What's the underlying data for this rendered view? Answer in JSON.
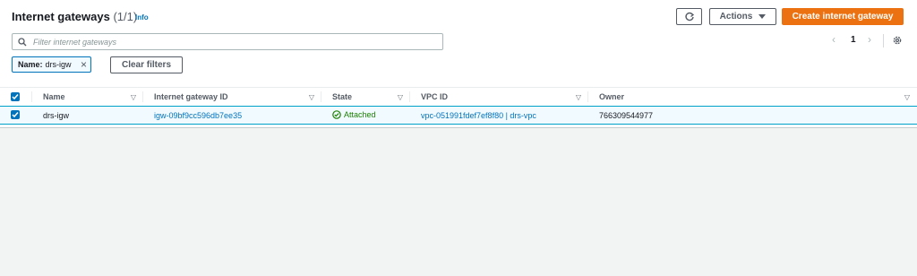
{
  "header": {
    "title": "Internet gateways",
    "count": "(1/1)",
    "info": "Info",
    "actions_label": "Actions",
    "create_label": "Create internet gateway"
  },
  "search": {
    "placeholder": "Filter internet gateways"
  },
  "filter": {
    "token_key": "Name:",
    "token_value": "drs-igw",
    "clear_label": "Clear filters"
  },
  "pagination": {
    "current_page": "1"
  },
  "table": {
    "columns": [
      "Name",
      "Internet gateway ID",
      "State",
      "VPC ID",
      "Owner"
    ],
    "rows": [
      {
        "name": "drs-igw",
        "igw_id": "igw-09bf9cc596db7ee35",
        "state": "Attached",
        "vpc_id": "vpc-051991fdef7ef8f80 | drs-vpc",
        "owner": "766309544977"
      }
    ]
  },
  "colors": {
    "accent": "#0073bb",
    "primary": "#ec7211",
    "success": "#1d8102"
  },
  "icons": [
    "search-icon",
    "refresh-icon",
    "caret-down-icon",
    "chevron-left-icon",
    "chevron-right-icon",
    "gear-icon",
    "close-icon",
    "check-circle-icon",
    "checkbox-checked-icon",
    "sort-icon"
  ]
}
